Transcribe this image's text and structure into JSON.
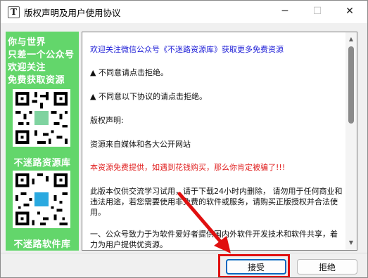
{
  "window": {
    "title": "版权声明及用户使用协议",
    "app_icon_letter": "T",
    "controls": {
      "minimize": "─",
      "maximize": "☐",
      "close": "✕"
    }
  },
  "sidebar": {
    "bg_color": "#63d66b",
    "promo_lines": [
      "你与世界",
      "只差一个公众号",
      "欢迎关注",
      "免费获取资源"
    ],
    "qr_banner_1": "不迷路资源库",
    "qr_banner_2": "不迷路软件库"
  },
  "agreement": {
    "paragraphs": [
      {
        "text": "欢迎关注微信公众号《不迷路资源库》获取更多免费资源",
        "color": "blue"
      },
      {
        "text": "▲ 不同意请点击拒绝。",
        "color": "black"
      },
      {
        "text": "▲ 不同意以下协议的请点击拒绝。",
        "color": "black"
      },
      {
        "text": "版权声明:",
        "color": "black"
      },
      {
        "text": "资源来自媒体和各大公开网站",
        "color": "black"
      },
      {
        "text": "本资源免费提供，如遇到花钱购买，那么你肯定被骗了!!!",
        "color": "red"
      },
      {
        "text": "此版本仅供交流学习试用，请于下载24小时内删除， 请勿用于任何商业和违法用途，若您需要使用非免费的软件或服务，请购买正版授权并合法使用。",
        "color": "black"
      },
      {
        "text": "一、公众号致力于为软件爱好者提供国内外软件开发技术和软件共享，着力为用户提供优资源。",
        "color": "black"
      }
    ]
  },
  "buttons": {
    "accept": "接受",
    "decline": "拒绝"
  },
  "colors": {
    "accent": "#0067c0",
    "annotation_red": "#e01010",
    "promo_green": "#63d66b",
    "link_blue": "#1a1ad6",
    "warning_red": "#e02020"
  },
  "icons": {
    "app": "app-t-icon",
    "scroll_up": "scroll-up-arrow-icon",
    "scroll_down": "scroll-down-arrow-icon",
    "annotation_arrow": "red-arrow-icon"
  }
}
